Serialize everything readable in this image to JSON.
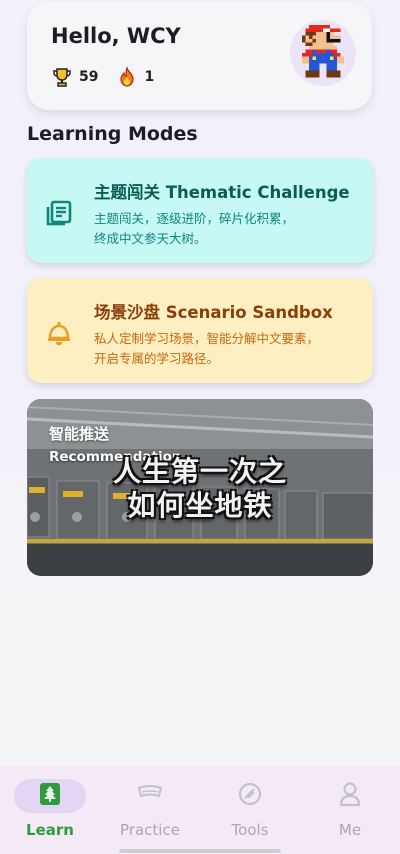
{
  "profile": {
    "greeting": "Hello, WCY",
    "trophies": "59",
    "streak": "1",
    "trophy_icon": "trophy-icon",
    "streak_icon": "flame-icon",
    "avatar_icon": "pixel-mario-avatar"
  },
  "section_title": "Learning Modes",
  "modes": [
    {
      "title": "主题闯关 Thematic Challenge",
      "desc_line1": "主题闯关，逐级进阶，碎片化积累，",
      "desc_line2": "终成中文参天大树。",
      "icon": "book-icon",
      "color": "#c6f9f4"
    },
    {
      "title": "场景沙盘 Scenario Sandbox",
      "desc_line1": "私人定制学习场景，智能分解中文要素，",
      "desc_line2": "开启专属的学习路径。",
      "icon": "bell-icon",
      "color": "#fdefc2"
    }
  ],
  "recommendation": {
    "title": "智能推送",
    "subtitle": "Recommendation",
    "overlay_line1": "人生第一次之",
    "overlay_line2": "如何坐地铁"
  },
  "tabs": [
    {
      "label": "Learn",
      "icon": "tree-icon",
      "active": true
    },
    {
      "label": "Practice",
      "icon": "practice-icon",
      "active": false
    },
    {
      "label": "Tools",
      "icon": "tools-icon",
      "active": false
    },
    {
      "label": "Me",
      "icon": "person-icon",
      "active": false
    }
  ],
  "colors": {
    "active_tab": "#2f9b3c",
    "inactive_tab": "#a9a9ad",
    "tab_bar_bg": "#f3eaf6"
  }
}
